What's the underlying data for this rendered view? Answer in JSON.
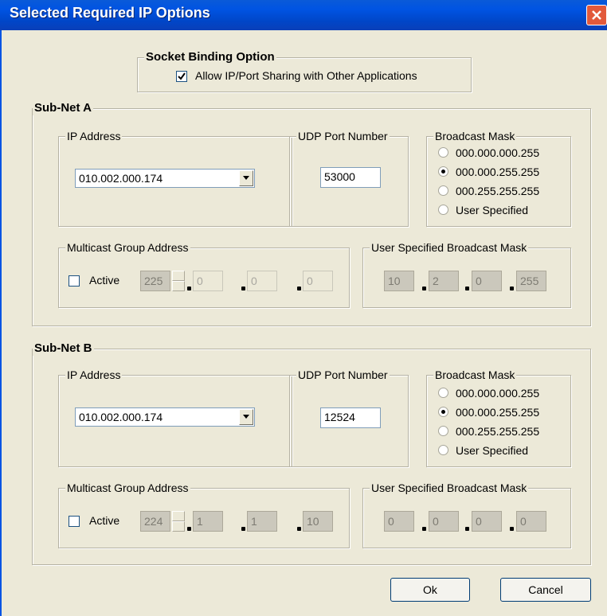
{
  "window": {
    "title": "Selected Required IP Options"
  },
  "socket": {
    "legend": "Socket Binding Option",
    "allow_label": "Allow IP/Port Sharing with Other Applications",
    "allow_checked": true
  },
  "subnet_a": {
    "legend": "Sub-Net A",
    "ip_legend": "IP Address",
    "ip_value": "010.002.000.174",
    "udp_legend": "UDP Port Number",
    "udp_value": "53000",
    "bmask_legend": "Broadcast Mask",
    "bmask_options": [
      "000.000.000.255",
      "000.000.255.255",
      "000.255.255.255",
      "User Specified"
    ],
    "bmask_selected": "000.000.255.255",
    "mcast_legend": "Multicast Group Address",
    "active_label": "Active",
    "active_checked": false,
    "mcast_octets": [
      "225",
      "0",
      "0",
      "0"
    ],
    "user_bmask_legend": "User Specified Broadcast Mask",
    "user_bmask_octets": [
      "10",
      "2",
      "0",
      "255"
    ]
  },
  "subnet_b": {
    "legend": "Sub-Net B",
    "ip_legend": "IP Address",
    "ip_value": "010.002.000.174",
    "udp_legend": "UDP Port Number",
    "udp_value": "12524",
    "bmask_legend": "Broadcast Mask",
    "bmask_options": [
      "000.000.000.255",
      "000.000.255.255",
      "000.255.255.255",
      "User Specified"
    ],
    "bmask_selected": "000.000.255.255",
    "mcast_legend": "Multicast Group Address",
    "active_label": "Active",
    "active_checked": false,
    "mcast_octets": [
      "224",
      "1",
      "1",
      "10"
    ],
    "user_bmask_legend": "User Specified Broadcast Mask",
    "user_bmask_octets": [
      "0",
      "0",
      "0",
      "0"
    ]
  },
  "buttons": {
    "ok": "Ok",
    "cancel": "Cancel"
  },
  "colors": {
    "titlebar": "#0054e3",
    "dialog_bg": "#ece9d8",
    "close": "#e2593b"
  },
  "icons": {
    "close": "close-icon",
    "dropdown": "chevron-down-icon",
    "check": "checkmark-icon"
  }
}
